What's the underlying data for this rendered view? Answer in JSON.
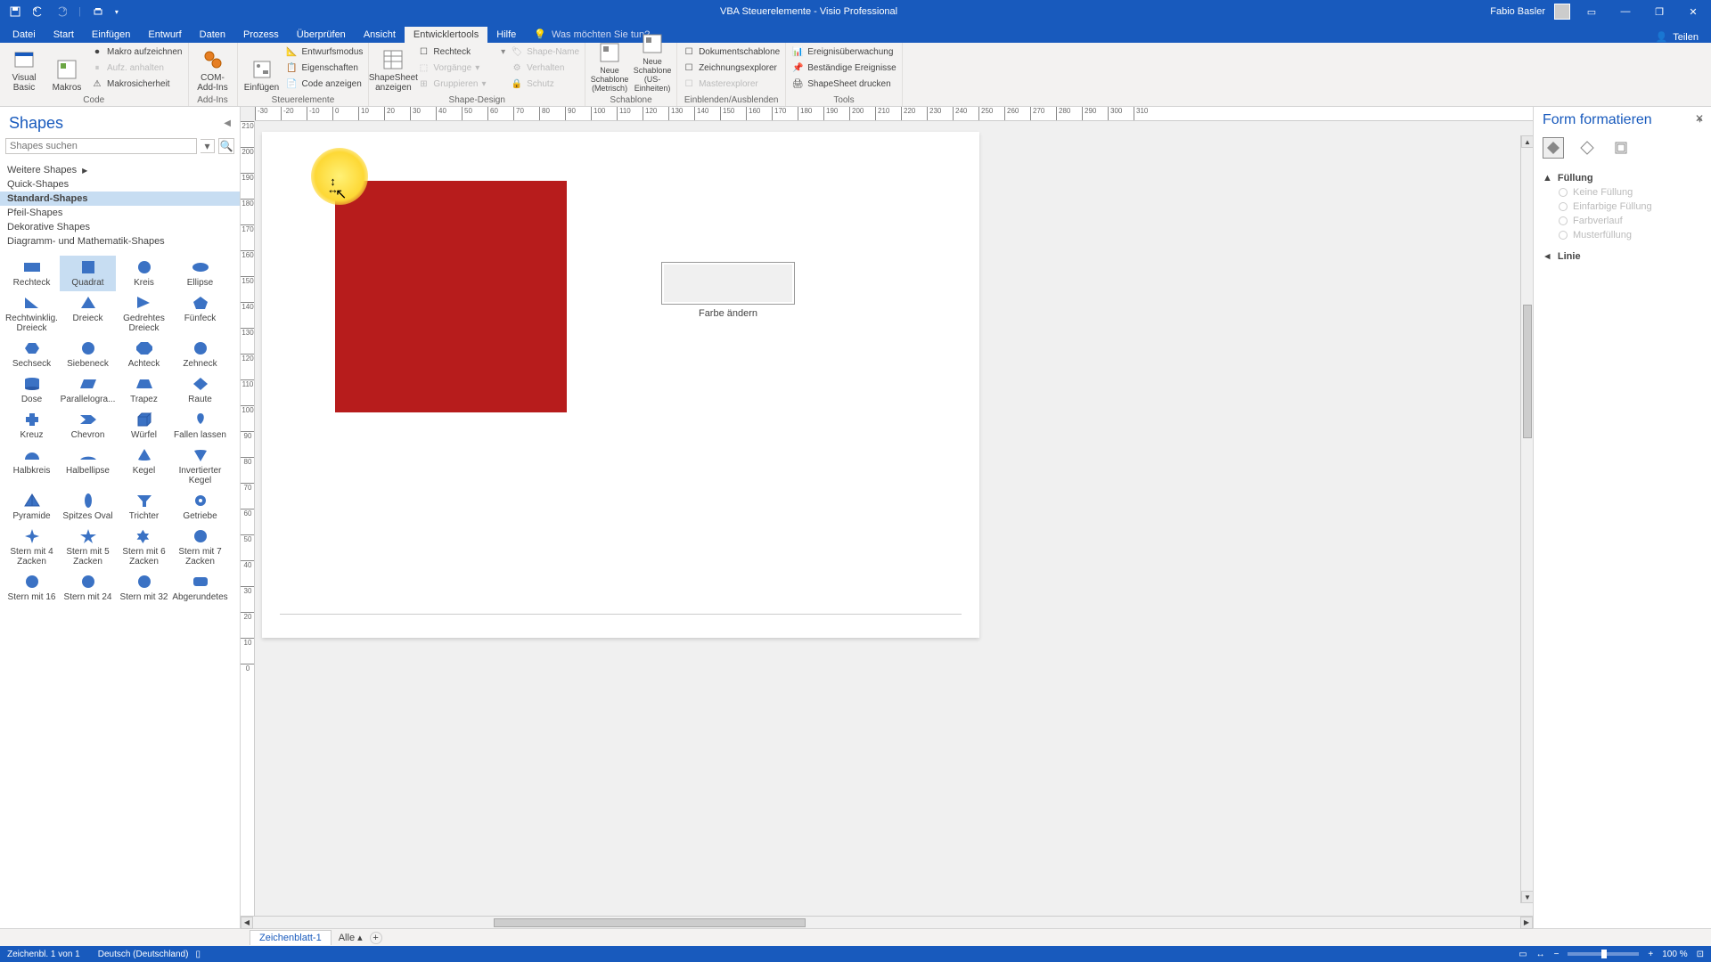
{
  "title_bar": {
    "app_title": "VBA Steuerelemente - Visio Professional",
    "user_name": "Fabio Basler"
  },
  "ribbon_tabs": {
    "datei": "Datei",
    "start": "Start",
    "einfuegen": "Einfügen",
    "entwurf": "Entwurf",
    "daten": "Daten",
    "prozess": "Prozess",
    "ueberpruefen": "Überprüfen",
    "ansicht": "Ansicht",
    "entwicklertools": "Entwicklertools",
    "hilfe": "Hilfe",
    "tell_me": "Was möchten Sie tun?",
    "share": "Teilen"
  },
  "ribbon": {
    "code": {
      "visual_basic": "Visual Basic",
      "makros": "Makros",
      "makro_aufzeichnen": "Makro aufzeichnen",
      "aufz_anhalten": "Aufz. anhalten",
      "makrosicherheit": "Makrosicherheit",
      "label": "Code"
    },
    "addins": {
      "com_addins": "COM-Add-Ins",
      "label": "Add-Ins"
    },
    "steuerelemente": {
      "einfuegen": "Einfügen",
      "entwurfsmodus": "Entwurfsmodus",
      "eigenschaften": "Eigenschaften",
      "code_anzeigen": "Code anzeigen",
      "label": "Steuerelemente"
    },
    "shape_design": {
      "shapesheet_anzeigen": "ShapeSheet anzeigen",
      "rechteck": "Rechteck",
      "vorgaenge": "Vorgänge",
      "gruppieren": "Gruppieren",
      "shape_name": "Shape-Name",
      "verhalten": "Verhalten",
      "schutz": "Schutz",
      "label": "Shape-Design"
    },
    "schablone": {
      "neu_metrisch": "Neue Schablone (Metrisch)",
      "neu_us": "Neue Schablone (US-Einheiten)",
      "label": "Schablone"
    },
    "ein_aus": {
      "dokumentschablone": "Dokumentschablone",
      "zeichnungsexplorer": "Zeichnungsexplorer",
      "masterexplorer": "Masterexplorer",
      "label": "Einblenden/Ausblenden"
    },
    "tools": {
      "ereignisueberwachung": "Ereignisüberwachung",
      "bestaendige_ereignisse": "Beständige Ereignisse",
      "shapesheet_drucken": "ShapeSheet drucken",
      "label": "Tools"
    }
  },
  "shapes_panel": {
    "title": "Shapes",
    "search_placeholder": "Shapes suchen",
    "categories": {
      "weitere": "Weitere Shapes",
      "quick": "Quick-Shapes",
      "standard": "Standard-Shapes",
      "pfeil": "Pfeil-Shapes",
      "dekorative": "Dekorative Shapes",
      "diagramm": "Diagramm- und Mathematik-Shapes"
    },
    "shapes": {
      "rechteck": "Rechteck",
      "quadrat": "Quadrat",
      "kreis": "Kreis",
      "ellipse": "Ellipse",
      "rechtw_dreieck": "Rechtwinklig. Dreieck",
      "dreieck": "Dreieck",
      "gedr_dreieck": "Gedrehtes Dreieck",
      "fuenfeck": "Fünfeck",
      "sechseck": "Sechseck",
      "siebeneck": "Siebeneck",
      "achteck": "Achteck",
      "zehneck": "Zehneck",
      "dose": "Dose",
      "parallelogramm": "Parallelogra...",
      "trapez": "Trapez",
      "raute": "Raute",
      "kreuz": "Kreuz",
      "chevron": "Chevron",
      "wuerfel": "Würfel",
      "fallen_lassen": "Fallen lassen",
      "halbkreis": "Halbkreis",
      "halbellipse": "Halbellipse",
      "kegel": "Kegel",
      "inv_kegel": "Invertierter Kegel",
      "pyramide": "Pyramide",
      "spitzes_oval": "Spitzes Oval",
      "trichter": "Trichter",
      "getriebe": "Getriebe",
      "stern4": "Stern mit 4 Zacken",
      "stern5": "Stern mit 5 Zacken",
      "stern6": "Stern mit 6 Zacken",
      "stern7": "Stern mit 7 Zacken",
      "stern16": "Stern mit 16",
      "stern24": "Stern mit 24",
      "stern32": "Stern mit 32",
      "abgerundet": "Abgerundetes"
    }
  },
  "canvas": {
    "button_label": "Farbe ändern"
  },
  "format_pane": {
    "title": "Form formatieren",
    "fuellung": "Füllung",
    "keine_fuellung": "Keine Füllung",
    "einfarbig": "Einfarbige Füllung",
    "farbverlauf": "Farbverlauf",
    "muster": "Musterfüllung",
    "linie": "Linie"
  },
  "page_tabs": {
    "page1": "Zeichenblatt-1",
    "alle": "Alle"
  },
  "status_bar": {
    "page_info": "Zeichenbl. 1 von 1",
    "language": "Deutsch (Deutschland)",
    "zoom": "100 %"
  },
  "ruler_h": [
    "-30",
    "-20",
    "-10",
    "0",
    "10",
    "20",
    "30",
    "40",
    "50",
    "60",
    "70",
    "80",
    "90",
    "100",
    "110",
    "120",
    "130",
    "140",
    "150",
    "160",
    "170",
    "180",
    "190",
    "200",
    "210",
    "220",
    "230",
    "240",
    "250",
    "260",
    "270",
    "280",
    "290",
    "300",
    "310"
  ],
  "ruler_v": [
    "210",
    "200",
    "190",
    "180",
    "170",
    "160",
    "150",
    "140",
    "130",
    "120",
    "110",
    "100",
    "90",
    "80",
    "70",
    "60",
    "50",
    "40",
    "30",
    "20",
    "10",
    "0"
  ]
}
